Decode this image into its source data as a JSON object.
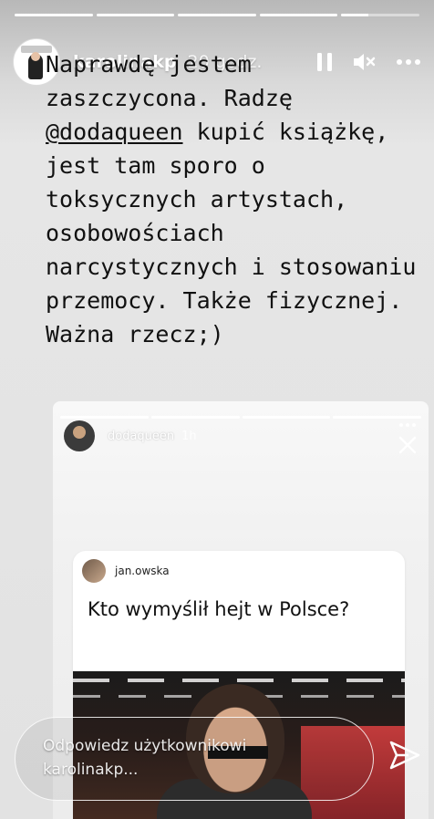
{
  "story": {
    "segments": [
      1,
      1,
      1,
      1,
      0.35
    ],
    "username": "karolinakp",
    "time": "20 godz.",
    "icons": {
      "pause": "pause-icon",
      "mute": "muted-speaker-icon",
      "more": "more-dots-icon"
    }
  },
  "caption": {
    "line_start": "Naprawdę jestem zaszczycona. Radzę ",
    "mention": "@dodaqueen",
    "line_end": " kupić książkę, jest tam sporo o toksycznych artystach, osobowościach narcystycznych i stosowaniu przemocy. Także fizycznej. Ważna rzecz;)"
  },
  "embed": {
    "username": "dodaqueen",
    "time": "1h",
    "question": {
      "asker": "jan.owska",
      "text": "Kto wymyślił hejt w Polsce?"
    }
  },
  "reply": {
    "placeholder": "Odpowiedz użytkownikowi karolinakp..."
  },
  "colors": {
    "text": "#111111",
    "overlay_text": "#ffffff",
    "background": "#e2e2e2"
  }
}
